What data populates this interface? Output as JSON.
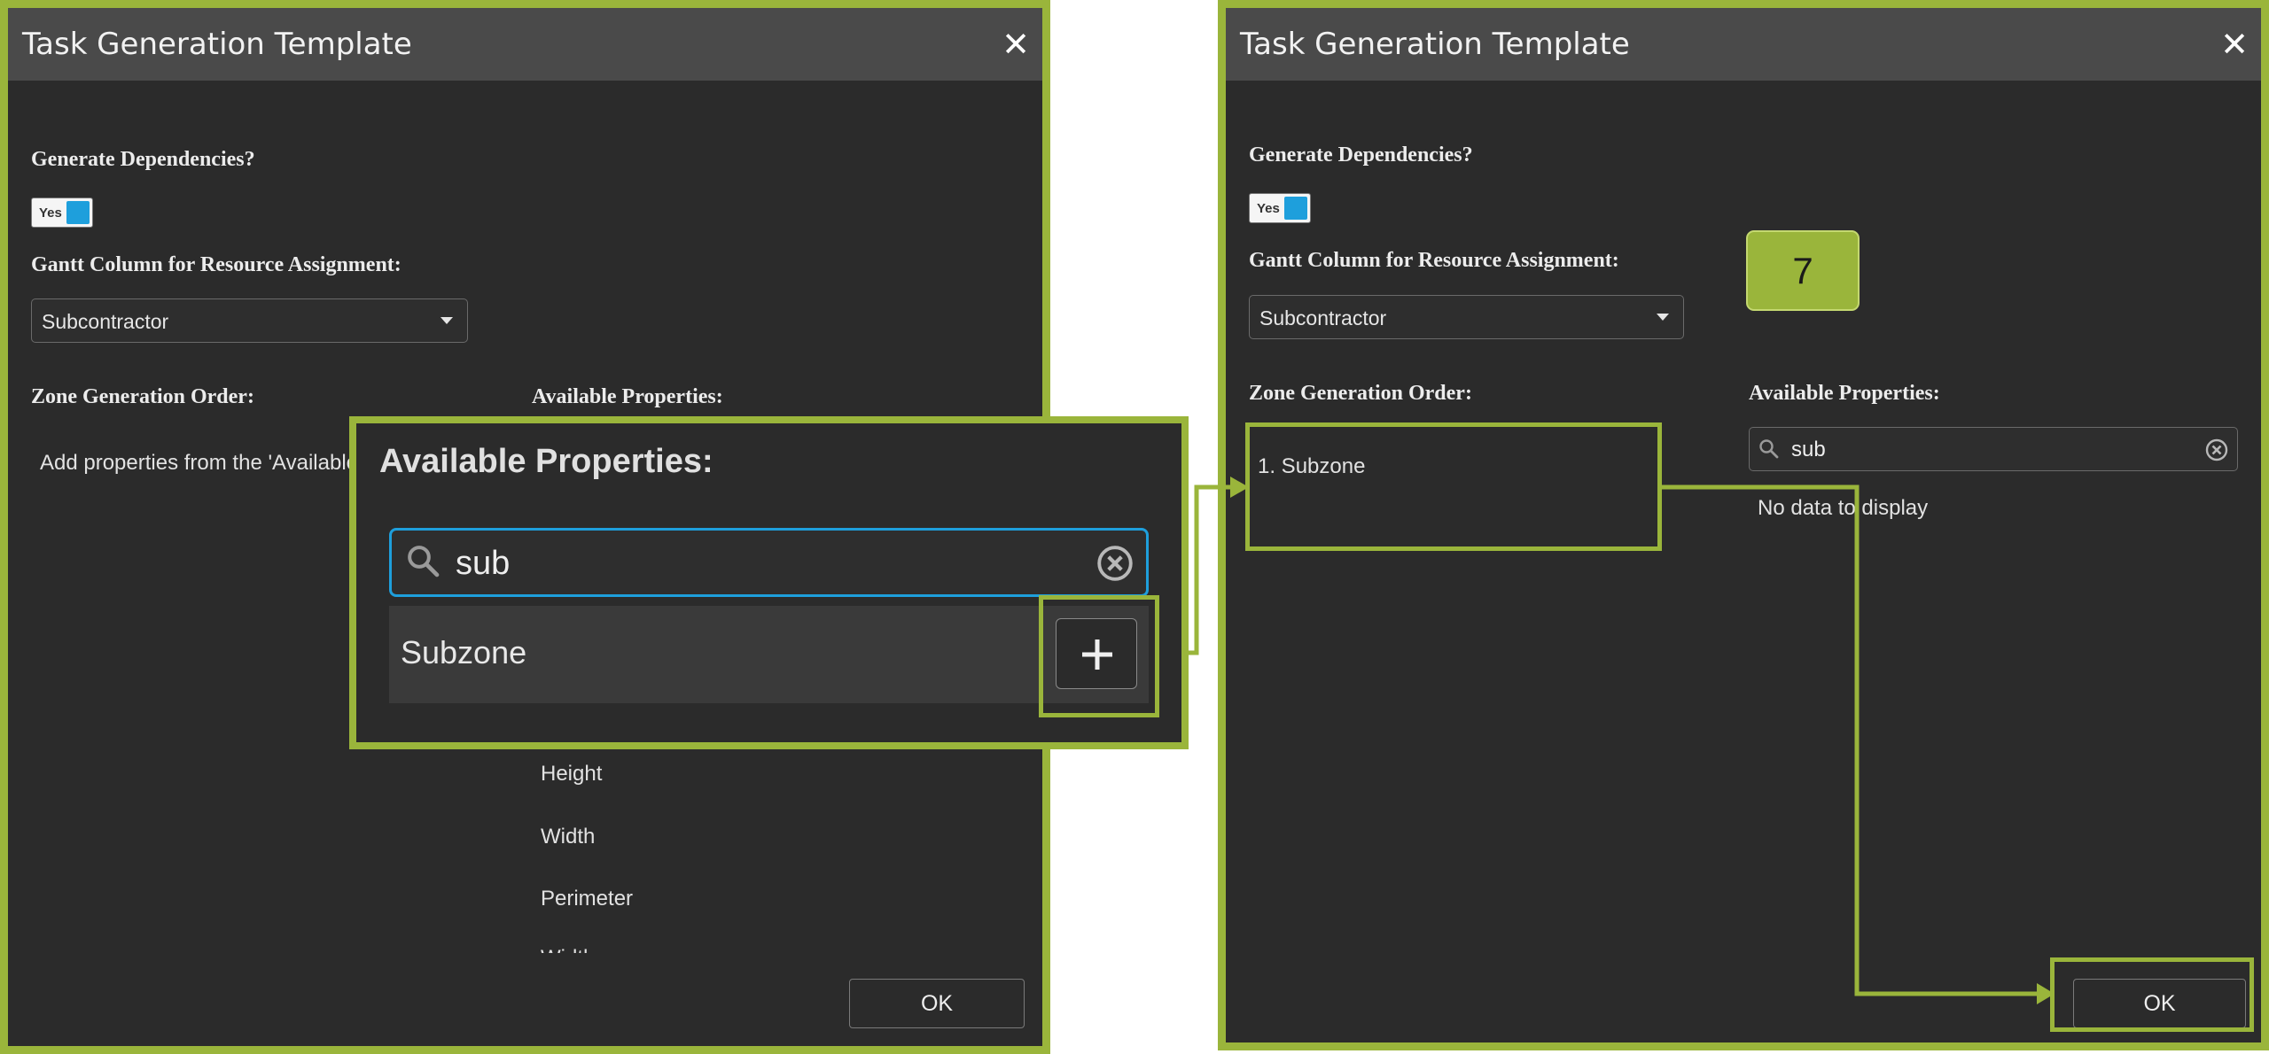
{
  "left_dialog": {
    "title": "Task Generation Template",
    "close": "✕",
    "generate_dependencies_label": "Generate Dependencies?",
    "toggle_label": "Yes",
    "gantt_column_label": "Gantt Column for Resource Assignment:",
    "gantt_column_value": "Subcontractor",
    "zone_order_label": "Zone Generation Order:",
    "zone_order_hint": "Add properties from the 'Available",
    "available_label": "Available Properties:",
    "properties": [
      "Height",
      "Width",
      "Perimeter",
      "Width"
    ],
    "ok_label": "OK"
  },
  "zoom_callout": {
    "title": "Available Properties:",
    "search_value": "sub",
    "result_item": "Subzone",
    "add_icon": "plus-icon"
  },
  "right_dialog": {
    "title": "Task Generation Template",
    "close": "✕",
    "generate_dependencies_label": "Generate Dependencies?",
    "toggle_label": "Yes",
    "gantt_column_label": "Gantt Column for Resource Assignment:",
    "gantt_column_value": "Subcontractor",
    "zone_order_label": "Zone Generation Order:",
    "zone_order_item": "1. Subzone",
    "available_label": "Available Properties:",
    "search_value": "sub",
    "no_data_text": "No data to display",
    "ok_label": "OK"
  },
  "step_badge": "7",
  "colors": {
    "accent_green": "#9ab53b",
    "dialog_bg": "#2b2b2b",
    "titlebar_bg": "#4a4a4a",
    "toggle_blue": "#1e9fdc"
  }
}
